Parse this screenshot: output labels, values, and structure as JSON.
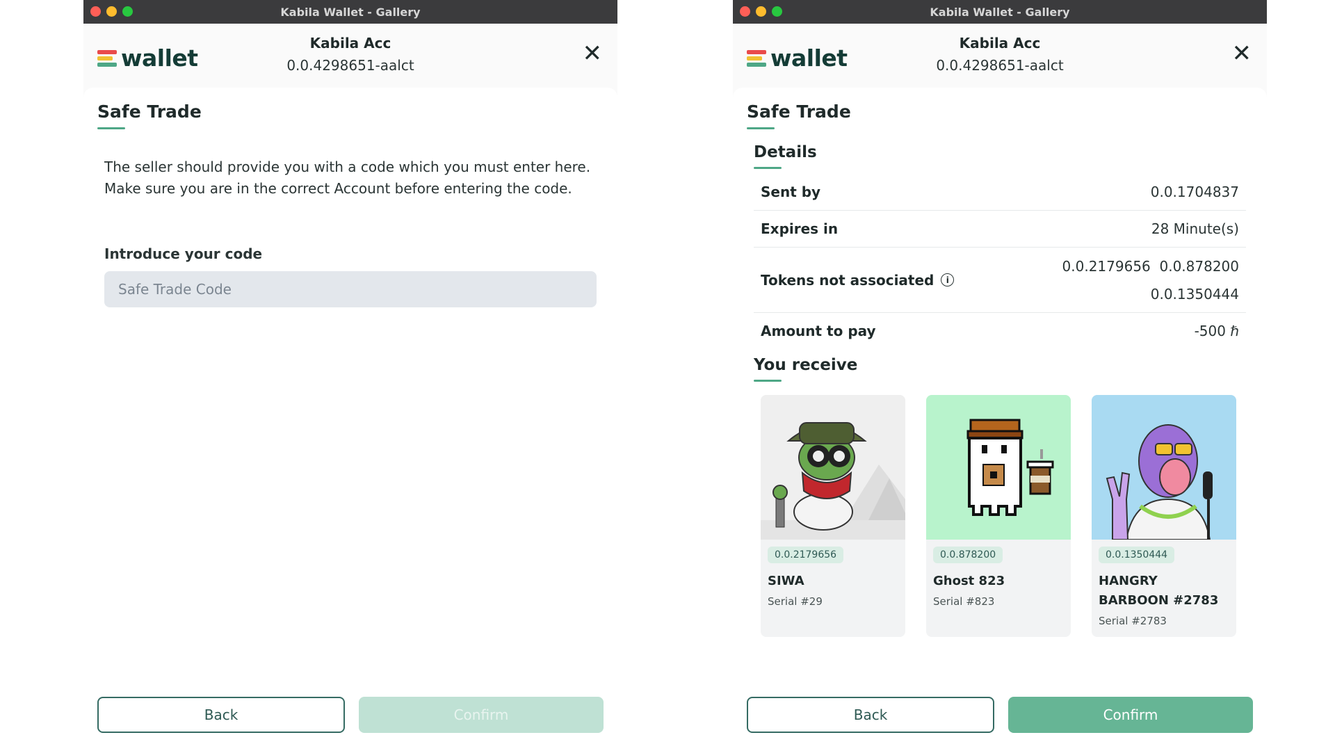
{
  "window": {
    "title": "Kabila Wallet - Gallery"
  },
  "brand": {
    "logo_text": "wallet",
    "colors": [
      "#e94b4b",
      "#f1c232",
      "#4ea786"
    ]
  },
  "account": {
    "name": "Kabila Acc",
    "id": "0.0.4298651-aalct"
  },
  "left": {
    "section_title": "Safe Trade",
    "description": "The seller should provide you with a code which you must enter here. Make sure you are in the correct Account before entering the code.",
    "field_label": "Introduce your code",
    "input_placeholder": "Safe Trade Code",
    "input_value": "",
    "back_label": "Back",
    "confirm_label": "Confirm",
    "confirm_enabled": false
  },
  "right": {
    "section_title": "Safe Trade",
    "details_title": "Details",
    "rows": [
      {
        "label": "Sent by",
        "value": "0.0.1704837"
      },
      {
        "label": "Expires in",
        "value": "28 Minute(s)"
      },
      {
        "label": "Tokens not associated",
        "values": [
          "0.0.2179656  0.0.878200",
          "0.0.1350444"
        ]
      },
      {
        "label": "Amount to pay",
        "value": "-500 ℏ"
      }
    ],
    "receive_title": "You receive",
    "nfts": [
      {
        "token_id": "0.0.2179656",
        "name": "SIWA",
        "serial": "Serial #29",
        "bg": "#eeeeee"
      },
      {
        "token_id": "0.0.878200",
        "name": "Ghost 823",
        "serial": "Serial #823",
        "bg": "#b8f3cc"
      },
      {
        "token_id": "0.0.1350444",
        "name": "HANGRY BARBOON #2783",
        "serial": "Serial #2783",
        "bg": "#a9daf2"
      }
    ],
    "back_label": "Back",
    "confirm_label": "Confirm",
    "confirm_enabled": true
  },
  "accent_color": "#4ea786"
}
